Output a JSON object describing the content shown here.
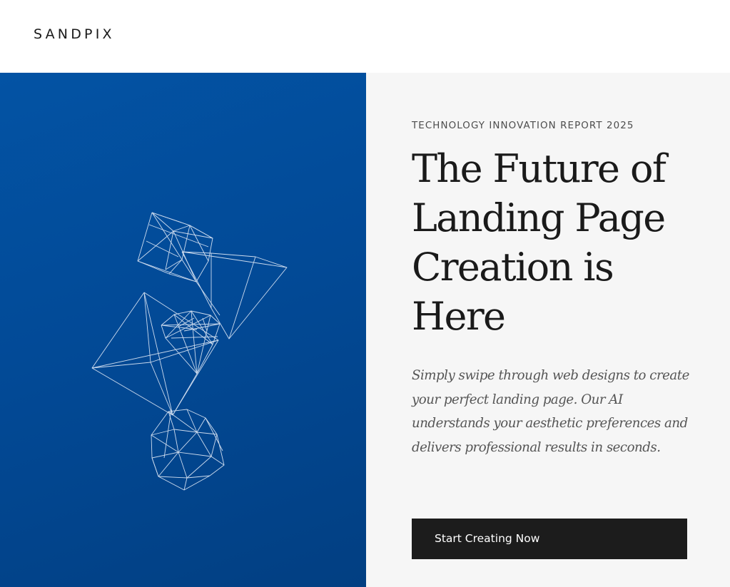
{
  "header": {
    "logo": "SANDPIX"
  },
  "hero": {
    "eyebrow": "TECHNOLOGY INNOVATION REPORT 2025",
    "headline": "The Future of Landing Page Creation is Here",
    "description": "Simply swipe through web designs to create your perfect landing page. Our AI understands your aesthetic preferences and delivers professional results in seconds.",
    "cta_label": "Start Creating Now"
  },
  "colors": {
    "art_blue": "#0353a4",
    "text_panel_bg": "#f6f6f6",
    "cta_bg": "#1c1c1c",
    "wireframe_line": "#ffffff"
  },
  "icons": {
    "illustration": "wireframe-polyhedra-illustration"
  }
}
